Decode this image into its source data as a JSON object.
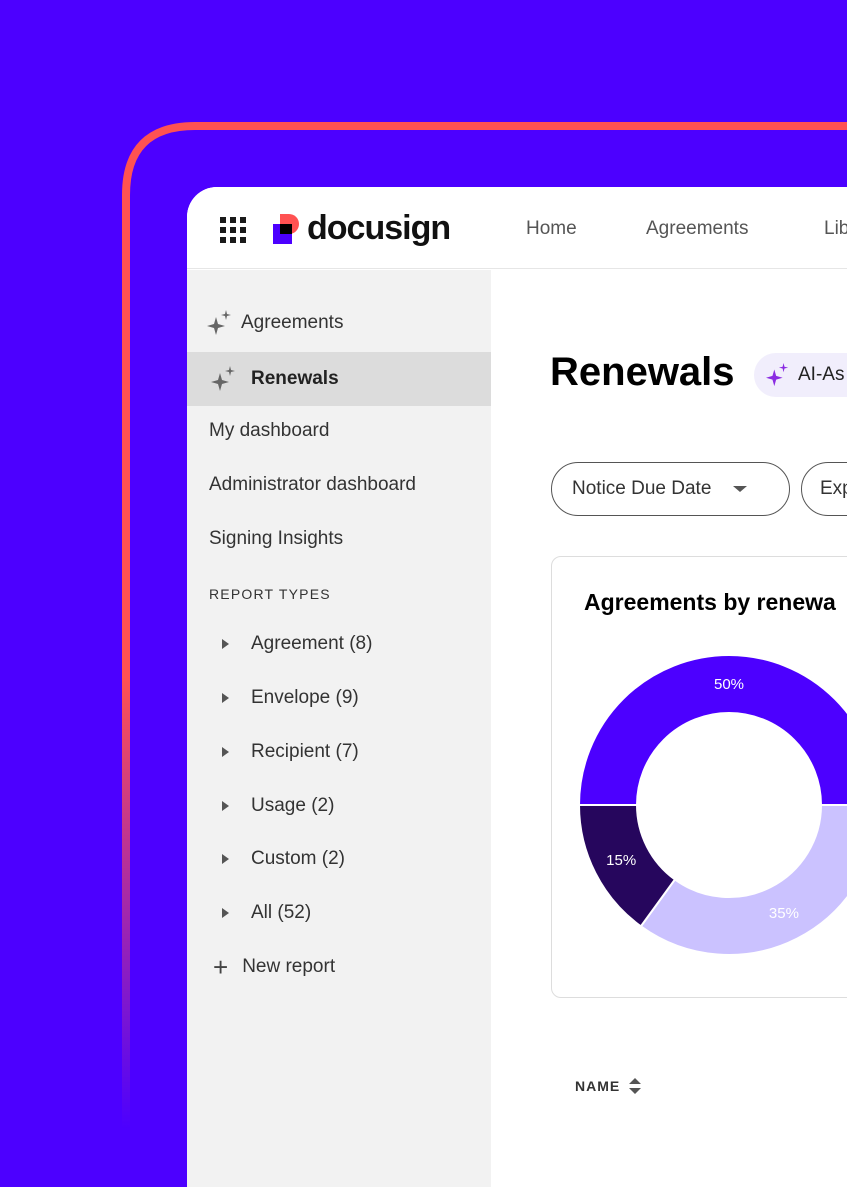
{
  "colors": {
    "background": "#4c00ff",
    "frame_accent": "#ff5252",
    "brand_purple": "#4c00ff",
    "dark_purple": "#26065d",
    "light_purple": "#cbc2ff"
  },
  "header": {
    "brand": "docusign",
    "nav": [
      "Home",
      "Agreements",
      "Lib"
    ],
    "apps_icon": "grid-icon"
  },
  "sidebar": {
    "items": [
      {
        "label": "Agreements",
        "icon": "sparkle-icon"
      },
      {
        "label": "Renewals",
        "icon": "sparkle-icon",
        "selected": true
      },
      {
        "label": "My dashboard"
      },
      {
        "label": "Administrator dashboard"
      },
      {
        "label": "Signing Insights"
      }
    ],
    "section_label": "REPORT TYPES",
    "report_types": [
      "Agreement (8)",
      "Envelope (9)",
      "Recipient (7)",
      "Usage (2)",
      "Custom (2)",
      "All (52)"
    ],
    "new_report": "New report"
  },
  "main": {
    "title": "Renewals",
    "ai_badge": "AI-As",
    "filters": [
      "Notice Due Date",
      "Exp"
    ],
    "table_header": {
      "name": "NAME"
    }
  },
  "chart_data": {
    "type": "pie",
    "donut": true,
    "title": "Agreements by renewa",
    "values": [
      50,
      35,
      15
    ],
    "labels": [
      "50%",
      "35%",
      "15%"
    ],
    "colors": [
      "#4c00ff",
      "#cbc2ff",
      "#26065d"
    ]
  }
}
